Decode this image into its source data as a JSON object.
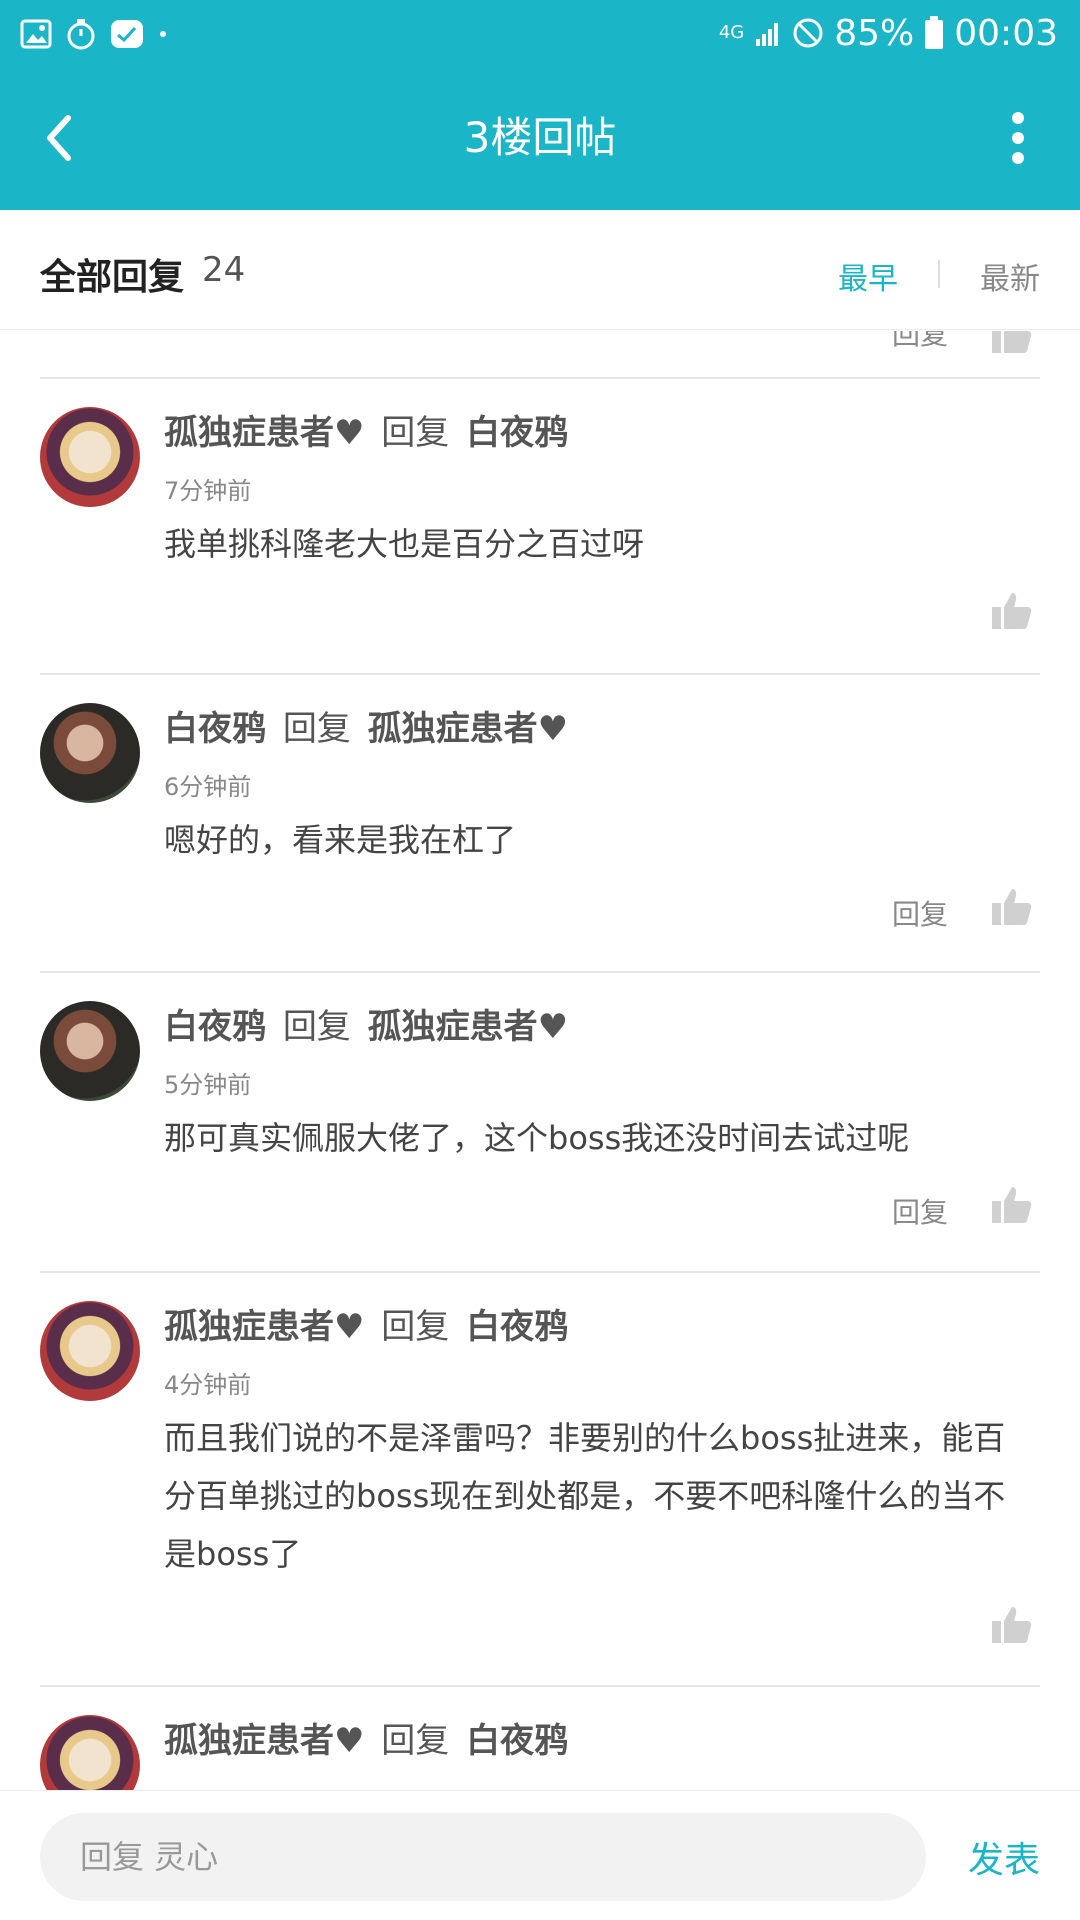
{
  "status_bar": {
    "network": "4G",
    "battery": "85%",
    "time": "00:03"
  },
  "app_bar": {
    "title": "3楼回帖",
    "back_icon": "chevron-left-icon",
    "menu_icon": "more-vertical-icon"
  },
  "subheader": {
    "all_replies_label": "全部回复",
    "count": "24",
    "sort_early": "最早",
    "sort_new": "最新"
  },
  "partial": {
    "reply_label": "回复"
  },
  "replies": [
    {
      "author": "孤独症患者♥",
      "verb": "回复",
      "target": "白夜鸦",
      "time": "7分钟前",
      "text": "我单挑科隆老大也是百分之百过呀",
      "show_reply_link": false
    },
    {
      "author": "白夜鸦",
      "verb": "回复",
      "target": "孤独症患者♥",
      "time": "6分钟前",
      "text": "嗯好的，看来是我在杠了",
      "show_reply_link": true,
      "reply_label": "回复"
    },
    {
      "author": "白夜鸦",
      "verb": "回复",
      "target": "孤独症患者♥",
      "time": "5分钟前",
      "text": "那可真实佩服大佬了，这个boss我还没时间去试过呢",
      "show_reply_link": true,
      "reply_label": "回复"
    },
    {
      "author": "孤独症患者♥",
      "verb": "回复",
      "target": "白夜鸦",
      "time": "4分钟前",
      "text": "而且我们说的不是泽雷吗？非要别的什么boss扯进来，能百分百单挑过的boss现在到处都是，不要不吧科隆什么的当不是boss了",
      "show_reply_link": false
    },
    {
      "author": "孤独症患者♥",
      "verb": "回复",
      "target": "白夜鸦"
    }
  ],
  "composer": {
    "placeholder": "回复 灵心",
    "send_label": "发表"
  }
}
